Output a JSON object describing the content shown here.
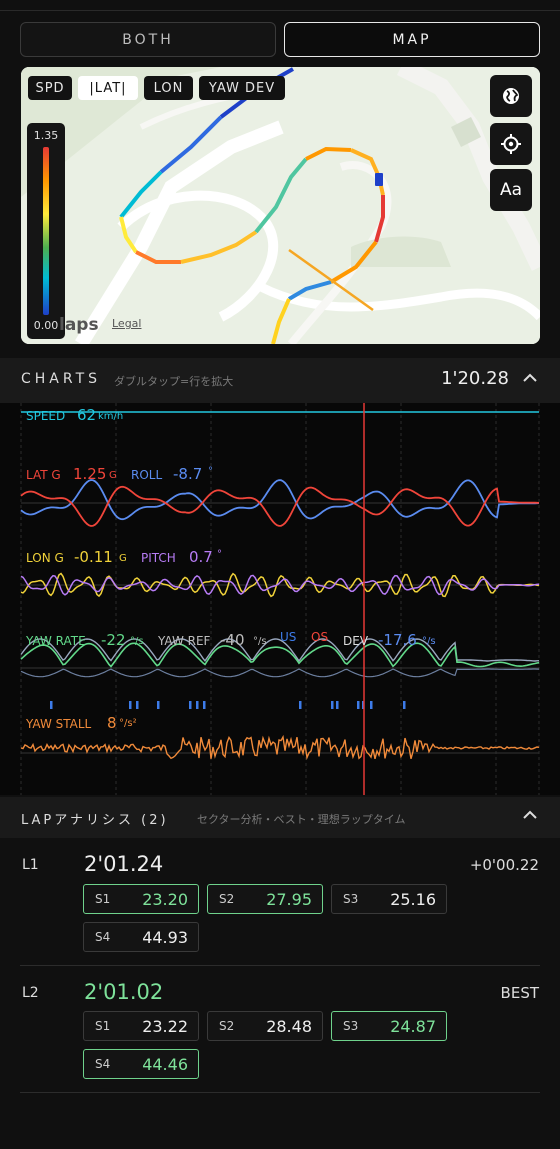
{
  "view_toggle": {
    "both_label": "BOTH",
    "map_label": "MAP"
  },
  "map": {
    "chips": [
      "SPD",
      "|LAT|",
      "LON",
      "YAW DEV"
    ],
    "selected_chip": "|LAT|",
    "legend_max": "1.35",
    "legend_min": "0.00",
    "logo_text": "laps",
    "legal_text": "Legal",
    "buttons": [
      "globe-icon",
      "crosshair-icon",
      "text-size-icon"
    ],
    "text_button_label": "Aa"
  },
  "charts": {
    "title": "CHARTS",
    "subtitle": "ダブルタップ=行を拡大",
    "lap_time": "1'20.28",
    "speed": {
      "label": "SPEED",
      "value": "62",
      "unit": "km/h",
      "color": "#22c8e0"
    },
    "lat_g": {
      "label": "LAT G",
      "value": "1.25",
      "unit": "G",
      "color": "#f0453a"
    },
    "roll": {
      "label": "ROLL",
      "value": "-8.7",
      "unit": "°",
      "color": "#5b8cf0"
    },
    "lon_g": {
      "label": "LON G",
      "value": "-0.11",
      "unit": "G",
      "color": "#f0d23a"
    },
    "pitch": {
      "label": "PITCH",
      "value": "0.7",
      "unit": "°",
      "color": "#b77cf5"
    },
    "yaw_rate": {
      "label": "YAW RATE",
      "value": "-22",
      "unit": "°/s",
      "color": "#62d98a"
    },
    "yaw_ref": {
      "label": "YAW REF",
      "value": "-40",
      "unit": "°/s",
      "color": "#bdbdbd"
    },
    "us_label": "US",
    "os_label": "OS",
    "dev": {
      "label": "DEV",
      "value": "-17.6",
      "unit": "°/s",
      "color": "#5b8cf0"
    },
    "yaw_stall": {
      "label": "YAW STALL",
      "value": "8",
      "unit": "°/s²",
      "color": "#f08a3a"
    }
  },
  "lap_analysis": {
    "title": "LAPアナリシス (2)",
    "subtitle": "セクター分析・ベスト・理想ラップタイム",
    "laps": [
      {
        "label": "L1",
        "time": "2'01.24",
        "delta": "+0'00.22",
        "sectors": [
          {
            "name": "S1",
            "value": "23.20",
            "best": true
          },
          {
            "name": "S2",
            "value": "27.95",
            "best": true
          },
          {
            "name": "S3",
            "value": "25.16",
            "best": false
          },
          {
            "name": "S4",
            "value": "44.93",
            "best": false
          }
        ]
      },
      {
        "label": "L2",
        "time": "2'01.02",
        "delta": "BEST",
        "sectors": [
          {
            "name": "S1",
            "value": "23.22",
            "best": false
          },
          {
            "name": "S2",
            "value": "28.48",
            "best": false
          },
          {
            "name": "S3",
            "value": "24.87",
            "best": true
          },
          {
            "name": "S4",
            "value": "44.46",
            "best": true
          }
        ]
      }
    ]
  },
  "colors": {
    "best_green": "#6fd28c",
    "cursor_red": "#e53935"
  }
}
